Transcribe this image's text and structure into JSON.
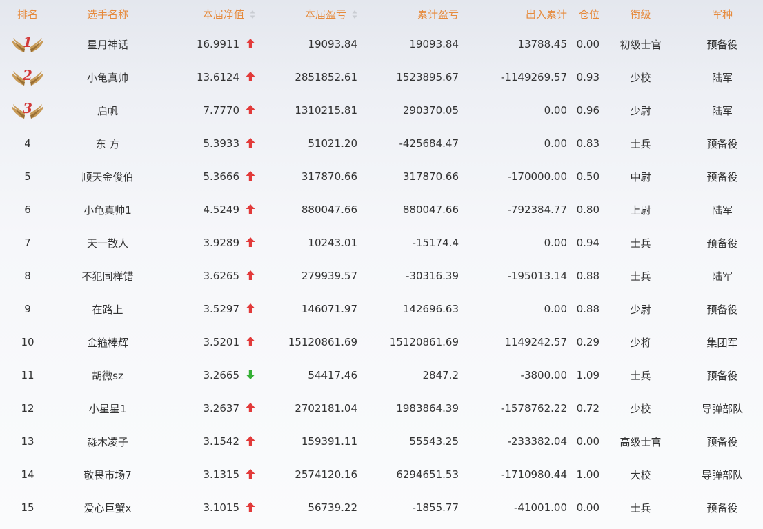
{
  "columns": {
    "rank": "排名",
    "name": "选手名称",
    "nav": "本届净值",
    "profit": "本届盈亏",
    "total_profit": "累计盈亏",
    "cash_flow": "出入累计",
    "position": "仓位",
    "title": "衔级",
    "branch": "军种"
  },
  "colors": {
    "header_text": "#e68a3c",
    "trend_up": "#e23a3a",
    "trend_down": "#35b035",
    "medal_number": "#d23a3a",
    "wing": "#c89b58"
  },
  "icons": {
    "sort": "sort-icon",
    "up": "arrow-up-icon",
    "down": "arrow-down-icon",
    "medal": "wings-medal-icon"
  },
  "rows": [
    {
      "rank": "1",
      "medal": true,
      "name": "星月神话",
      "nav": "16.9911",
      "trend": "up",
      "profit": "19093.84",
      "total_profit": "19093.84",
      "cash_flow": "13788.45",
      "position": "0.00",
      "title": "初级士官",
      "branch": "预备役"
    },
    {
      "rank": "2",
      "medal": true,
      "name": "小龟真帅",
      "nav": "13.6124",
      "trend": "up",
      "profit": "2851852.61",
      "total_profit": "1523895.67",
      "cash_flow": "-1149269.57",
      "position": "0.93",
      "title": "少校",
      "branch": "陆军"
    },
    {
      "rank": "3",
      "medal": true,
      "name": "启帆",
      "nav": "7.7770",
      "trend": "up",
      "profit": "1310215.81",
      "total_profit": "290370.05",
      "cash_flow": "0.00",
      "position": "0.96",
      "title": "少尉",
      "branch": "陆军"
    },
    {
      "rank": "4",
      "medal": false,
      "name": "东 方",
      "nav": "5.3933",
      "trend": "up",
      "profit": "51021.20",
      "total_profit": "-425684.47",
      "cash_flow": "0.00",
      "position": "0.83",
      "title": "士兵",
      "branch": "预备役"
    },
    {
      "rank": "5",
      "medal": false,
      "name": "顺天金俊伯",
      "nav": "5.3666",
      "trend": "up",
      "profit": "317870.66",
      "total_profit": "317870.66",
      "cash_flow": "-170000.00",
      "position": "0.50",
      "title": "中尉",
      "branch": "预备役"
    },
    {
      "rank": "6",
      "medal": false,
      "name": "小龟真帅1",
      "nav": "4.5249",
      "trend": "up",
      "profit": "880047.66",
      "total_profit": "880047.66",
      "cash_flow": "-792384.77",
      "position": "0.80",
      "title": "上尉",
      "branch": "陆军"
    },
    {
      "rank": "7",
      "medal": false,
      "name": "天一散人",
      "nav": "3.9289",
      "trend": "up",
      "profit": "10243.01",
      "total_profit": "-15174.4",
      "cash_flow": "0.00",
      "position": "0.94",
      "title": "士兵",
      "branch": "预备役"
    },
    {
      "rank": "8",
      "medal": false,
      "name": "不犯同样错",
      "nav": "3.6265",
      "trend": "up",
      "profit": "279939.57",
      "total_profit": "-30316.39",
      "cash_flow": "-195013.14",
      "position": "0.88",
      "title": "士兵",
      "branch": "陆军"
    },
    {
      "rank": "9",
      "medal": false,
      "name": "在路上",
      "nav": "3.5297",
      "trend": "up",
      "profit": "146071.97",
      "total_profit": "142696.63",
      "cash_flow": "0.00",
      "position": "0.88",
      "title": "少尉",
      "branch": "预备役"
    },
    {
      "rank": "10",
      "medal": false,
      "name": "金箍棒辉",
      "nav": "3.5201",
      "trend": "up",
      "profit": "15120861.69",
      "total_profit": "15120861.69",
      "cash_flow": "1149242.57",
      "position": "0.29",
      "title": "少将",
      "branch": "集团军"
    },
    {
      "rank": "11",
      "medal": false,
      "name": "胡微sz",
      "nav": "3.2665",
      "trend": "down",
      "profit": "54417.46",
      "total_profit": "2847.2",
      "cash_flow": "-3800.00",
      "position": "1.09",
      "title": "士兵",
      "branch": "预备役"
    },
    {
      "rank": "12",
      "medal": false,
      "name": "小星星1",
      "nav": "3.2637",
      "trend": "up",
      "profit": "2702181.04",
      "total_profit": "1983864.39",
      "cash_flow": "-1578762.22",
      "position": "0.72",
      "title": "少校",
      "branch": "导弹部队"
    },
    {
      "rank": "13",
      "medal": false,
      "name": "淼木凌子",
      "nav": "3.1542",
      "trend": "up",
      "profit": "159391.11",
      "total_profit": "55543.25",
      "cash_flow": "-233382.04",
      "position": "0.00",
      "title": "高级士官",
      "branch": "预备役"
    },
    {
      "rank": "14",
      "medal": false,
      "name": "敬畏市场7",
      "nav": "3.1315",
      "trend": "up",
      "profit": "2574120.16",
      "total_profit": "6294651.53",
      "cash_flow": "-1710980.44",
      "position": "1.00",
      "title": "大校",
      "branch": "导弹部队"
    },
    {
      "rank": "15",
      "medal": false,
      "name": "爱心巨蟹x",
      "nav": "3.1015",
      "trend": "up",
      "profit": "56739.22",
      "total_profit": "-1855.77",
      "cash_flow": "-41001.00",
      "position": "0.00",
      "title": "士兵",
      "branch": "预备役"
    }
  ]
}
